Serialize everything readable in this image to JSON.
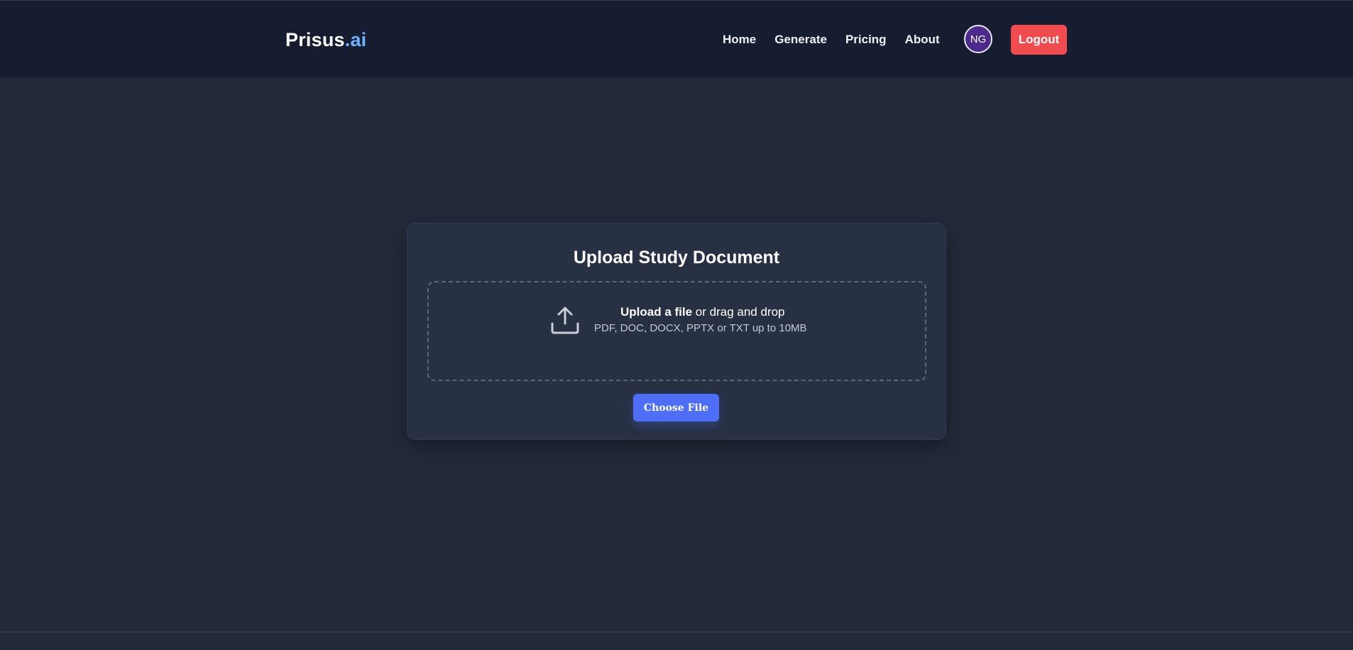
{
  "header": {
    "brand_main": "Prisus",
    "brand_accent": ".ai",
    "nav": [
      "Home",
      "Generate",
      "Pricing",
      "About"
    ],
    "avatar_initials": "NG",
    "logout_label": "Logout"
  },
  "upload": {
    "title": "Upload Study Document",
    "link_text": "Upload a file",
    "rest_text": " or drag and drop",
    "hint": "PDF, DOC, DOCX, PPTX or TXT up to 10MB",
    "choose_label": "Choose File",
    "icon": "upload-icon"
  },
  "colors": {
    "accent_blue": "#4d6ef5",
    "logout_red": "#f04b4f",
    "brand_accent": "#6fb0ff"
  }
}
